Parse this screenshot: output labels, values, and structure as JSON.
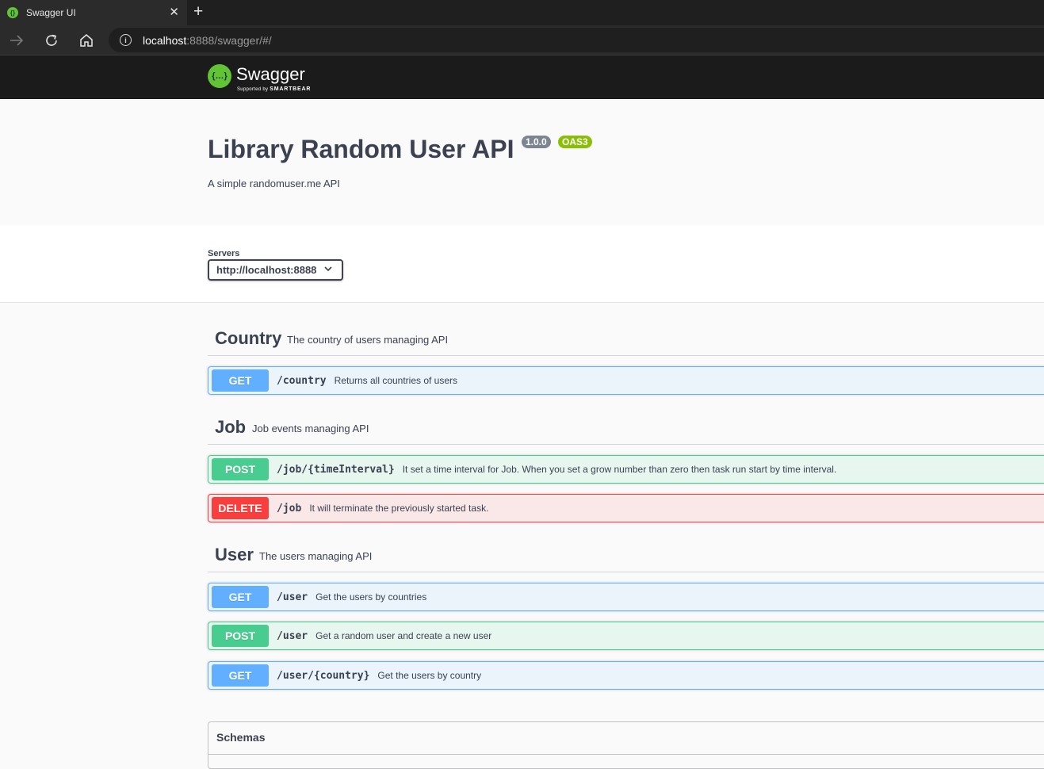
{
  "browser": {
    "tab_title": "Swagger UI",
    "url_host": "localhost",
    "url_rest": ":8888/swagger/#/"
  },
  "topbar": {
    "logo_text": "Swagger",
    "logo_sub_prefix": "Supported by",
    "logo_sub_brand": "SMARTBEAR"
  },
  "info": {
    "title": "Library Random User API",
    "version": "1.0.0",
    "oas_badge": "OAS3",
    "description": "A simple randomuser.me API"
  },
  "servers": {
    "label": "Servers",
    "selected": "http://localhost:8888"
  },
  "tags": [
    {
      "name": "Country",
      "description": "The country of users managing API",
      "operations": [
        {
          "method": "GET",
          "path": "/country",
          "summary": "Returns all countries of users"
        }
      ]
    },
    {
      "name": "Job",
      "description": "Job events managing API",
      "operations": [
        {
          "method": "POST",
          "path": "/job/{timeInterval}",
          "summary": "It set a time interval for Job. When you set a grow number than zero then task run start by time interval."
        },
        {
          "method": "DELETE",
          "path": "/job",
          "summary": "It will terminate the previously started task."
        }
      ]
    },
    {
      "name": "User",
      "description": "The users managing API",
      "operations": [
        {
          "method": "GET",
          "path": "/user",
          "summary": "Get the users by countries"
        },
        {
          "method": "POST",
          "path": "/user",
          "summary": "Get a random user and create a new user"
        },
        {
          "method": "GET",
          "path": "/user/{country}",
          "summary": "Get the users by country"
        }
      ]
    }
  ],
  "schemas": {
    "title": "Schemas"
  },
  "colors": {
    "get": "#61affe",
    "post": "#49cc90",
    "delete": "#f93e3e",
    "swagger_green": "#62c334",
    "oas_badge": "#89bf04",
    "version_badge": "#7d8492"
  }
}
